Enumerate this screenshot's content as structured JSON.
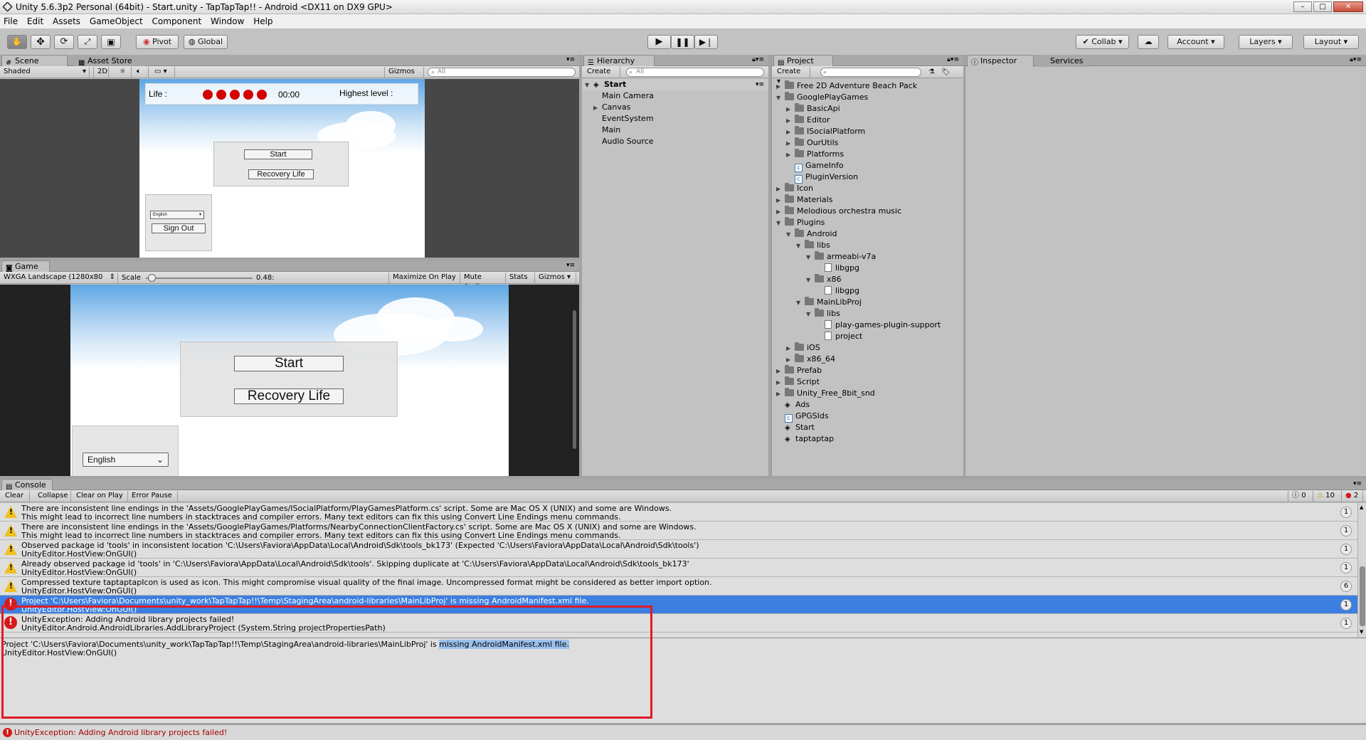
{
  "window": {
    "title": "Unity 5.6.3p2 Personal (64bit) - Start.unity - TapTapTap!! - Android <DX11 on DX9 GPU>"
  },
  "menu": [
    "File",
    "Edit",
    "Assets",
    "GameObject",
    "Component",
    "Window",
    "Help"
  ],
  "toolbar": {
    "pivot": "Pivot",
    "global": "Global",
    "collab": "Collab",
    "account": "Account",
    "layers": "Layers",
    "layout": "Layout"
  },
  "scene": {
    "tab": "Scene",
    "tab_asset_store": "Asset Store",
    "shading": "Shaded",
    "mode_2d": "2D",
    "gizmos": "Gizmos",
    "search_placeholder": "All",
    "life_label": "Life :",
    "timer": "00:00",
    "highest_label": "Highest level :",
    "start": "Start",
    "recovery": "Recovery Life",
    "language": "English",
    "sign_out": "Sign Out"
  },
  "game": {
    "tab": "Game",
    "resolution": "WXGA Landscape (1280x80",
    "scale_label": "Scale",
    "scale_value": "0.48:",
    "scale_fraction": 0.05,
    "maximize": "Maximize On Play",
    "mute": "Mute Audio",
    "stats": "Stats",
    "gizmos": "Gizmos",
    "start": "Start",
    "recovery": "Recovery Life",
    "language": "English"
  },
  "hierarchy": {
    "tab": "Hierarchy",
    "create": "Create",
    "search_placeholder": "All",
    "scene": "Start",
    "items": [
      "Main Camera",
      "Canvas",
      "EventSystem",
      "Main",
      "Audio Source"
    ]
  },
  "project": {
    "tab": "Project",
    "create": "Create",
    "tree": [
      {
        "label": "Free 2D Adventure Beach Pack",
        "icon": "folder",
        "arrow": "right"
      },
      {
        "label": "GooglePlayGames",
        "icon": "folder",
        "arrow": "down"
      },
      {
        "label": "BasicApi",
        "icon": "folder",
        "arrow": "right"
      },
      {
        "label": "Editor",
        "icon": "folder",
        "arrow": "right"
      },
      {
        "label": "ISocialPlatform",
        "icon": "folder",
        "arrow": "right"
      },
      {
        "label": "OurUtils",
        "icon": "folder",
        "arrow": "right"
      },
      {
        "label": "Platforms",
        "icon": "folder",
        "arrow": "right"
      },
      {
        "label": "GameInfo",
        "icon": "script",
        "arrow": ""
      },
      {
        "label": "PluginVersion",
        "icon": "script",
        "arrow": ""
      },
      {
        "label": "Icon",
        "icon": "folder",
        "arrow": "right"
      },
      {
        "label": "Materials",
        "icon": "folder",
        "arrow": "right"
      },
      {
        "label": "Melodious orchestra music",
        "icon": "folder",
        "arrow": "right"
      },
      {
        "label": "Plugins",
        "icon": "folder",
        "arrow": "down"
      },
      {
        "label": "Android",
        "icon": "folder",
        "arrow": "down"
      },
      {
        "label": "libs",
        "icon": "folder",
        "arrow": "down"
      },
      {
        "label": "armeabi-v7a",
        "icon": "folder",
        "arrow": "down"
      },
      {
        "label": "libgpg",
        "icon": "file",
        "arrow": ""
      },
      {
        "label": "x86",
        "icon": "folder",
        "arrow": "down"
      },
      {
        "label": "libgpg",
        "icon": "file",
        "arrow": ""
      },
      {
        "label": "MainLibProj",
        "icon": "folder",
        "arrow": "down"
      },
      {
        "label": "libs",
        "icon": "folder",
        "arrow": "down"
      },
      {
        "label": "play-games-plugin-support",
        "icon": "file",
        "arrow": ""
      },
      {
        "label": "project",
        "icon": "file",
        "arrow": ""
      },
      {
        "label": "iOS",
        "icon": "folder",
        "arrow": "right"
      },
      {
        "label": "x86_64",
        "icon": "folder",
        "arrow": "right"
      },
      {
        "label": "Prefab",
        "icon": "folder",
        "arrow": "right"
      },
      {
        "label": "Script",
        "icon": "folder",
        "arrow": "right"
      },
      {
        "label": "Unity_Free_8bit_snd",
        "icon": "folder",
        "arrow": "right"
      },
      {
        "label": "Ads",
        "icon": "unity",
        "arrow": ""
      },
      {
        "label": "GPGSIds",
        "icon": "script",
        "arrow": ""
      },
      {
        "label": "Start",
        "icon": "unity",
        "arrow": ""
      },
      {
        "label": "taptaptap",
        "icon": "unity",
        "arrow": ""
      }
    ]
  },
  "inspector": {
    "tab": "Inspector",
    "services": "Services"
  },
  "console": {
    "tab": "Console",
    "clear": "Clear",
    "collapse": "Collapse",
    "clear_on_play": "Clear on Play",
    "error_pause": "Error Pause",
    "count_info": "0",
    "count_warn": "10",
    "count_error": "2",
    "entries": [
      {
        "type": "warning",
        "line1": "There are inconsistent line endings in the 'Assets/GooglePlayGames/ISocialPlatform/PlayGamesPlatform.cs' script. Some are Mac OS X (UNIX) and some are Windows.",
        "line2": "This might lead to incorrect line numbers in stacktraces and compiler errors. Many text editors can fix this using Convert Line Endings menu commands.",
        "count": "1"
      },
      {
        "type": "warning",
        "line1": "There are inconsistent line endings in the 'Assets/GooglePlayGames/Platforms/NearbyConnectionClientFactory.cs' script. Some are Mac OS X (UNIX) and some are Windows.",
        "line2": "This might lead to incorrect line numbers in stacktraces and compiler errors. Many text editors can fix this using Convert Line Endings menu commands.",
        "count": "1"
      },
      {
        "type": "warning",
        "line1": " Observed package id 'tools' in inconsistent location 'C:\\Users\\Faviora\\AppData\\Local\\Android\\Sdk\\tools_bk173' (Expected 'C:\\Users\\Faviora\\AppData\\Local\\Android\\Sdk\\tools')",
        "line2": "UnityEditor.HostView:OnGUI()",
        "count": "1"
      },
      {
        "type": "warning",
        "line1": " Already observed package id 'tools' in 'C:\\Users\\Faviora\\AppData\\Local\\Android\\Sdk\\tools'. Skipping duplicate at 'C:\\Users\\Faviora\\AppData\\Local\\Android\\Sdk\\tools_bk173'",
        "line2": "UnityEditor.HostView:OnGUI()",
        "count": "1"
      },
      {
        "type": "warning",
        "line1": "Compressed texture taptaptapIcon is used as icon. This might compromise visual quality of the final image. Uncompressed format might be considered as better import option.",
        "line2": "UnityEditor.HostView:OnGUI()",
        "count": "6"
      },
      {
        "type": "error",
        "line1": "Project 'C:\\Users\\Faviora\\Documents\\unity_work\\TapTapTap!!\\Temp\\StagingArea\\android-libraries\\MainLibProj' is missing AndroidManifest.xml file.",
        "line2": "UnityEditor.HostView:OnGUI()",
        "count": "1",
        "selected": true
      },
      {
        "type": "error",
        "line1": "UnityException: Adding Android library projects failed!",
        "line2": "UnityEditor.Android.AndroidLibraries.AddLibraryProject (System.String projectPropertiesPath)",
        "count": "1"
      }
    ],
    "detail_line1_a": "Project 'C:\\Users\\Faviora\\Documents\\unity_work\\TapTapTap!!\\Temp\\StagingArea\\android-libraries\\MainLibProj' is ",
    "detail_line1_b": "missing AndroidManifest.xml file.",
    "detail_line2": "UnityEditor.HostView:OnGUI()"
  },
  "statusbar": {
    "text": "UnityException: Adding Android library projects failed!"
  },
  "colors": {
    "selection": "#3d7fe0",
    "highlight_box": "#e01b24",
    "error": "#d41a1a",
    "warning": "#f0c020"
  }
}
